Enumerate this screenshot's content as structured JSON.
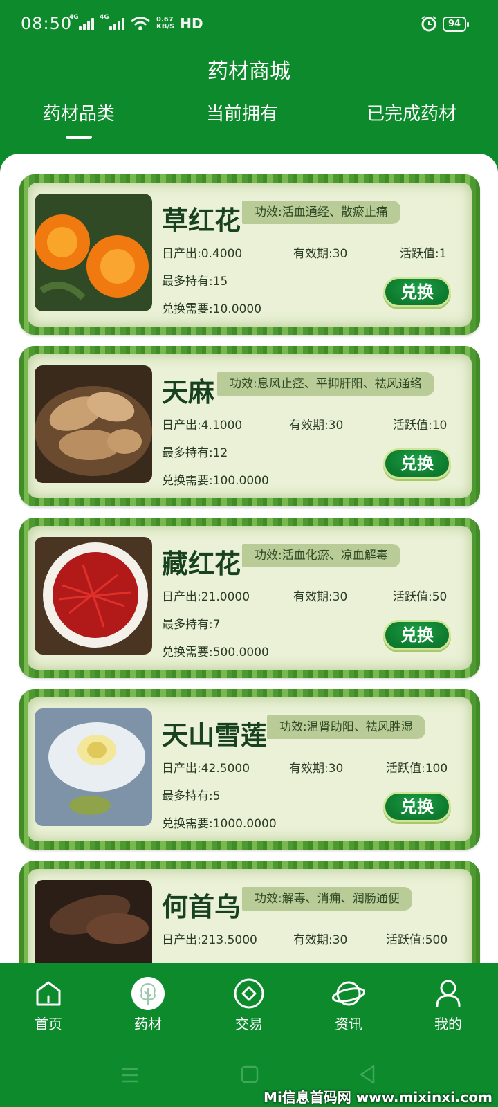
{
  "status": {
    "time": "08:50",
    "signal1": "4G",
    "signal2": "4G",
    "speed_value": "0.67",
    "speed_unit": "KB/S",
    "hd": "HD",
    "battery": "94"
  },
  "header": {
    "title": "药材商城",
    "tabs": [
      "药材品类",
      "当前拥有",
      "已完成药材"
    ],
    "active_tab": "药材品类"
  },
  "items": [
    {
      "name": "草红花",
      "effect": "功效:活血通经、散瘀止痛",
      "daily_output": "日产出:0.4000",
      "validity": "有效期:30",
      "activity": "活跃值:1",
      "max_hold": "最多持有:15",
      "exchange_need": "兑换需要:10.0000",
      "button": "兑换"
    },
    {
      "name": "天麻",
      "effect": "功效:息风止痉、平抑肝阳、祛风通络",
      "daily_output": "日产出:4.1000",
      "validity": "有效期:30",
      "activity": "活跃值:10",
      "max_hold": "最多持有:12",
      "exchange_need": "兑换需要:100.0000",
      "button": "兑换"
    },
    {
      "name": "藏红花",
      "effect": "功效:活血化瘀、凉血解毒",
      "daily_output": "日产出:21.0000",
      "validity": "有效期:30",
      "activity": "活跃值:50",
      "max_hold": "最多持有:7",
      "exchange_need": "兑换需要:500.0000",
      "button": "兑换"
    },
    {
      "name": "天山雪莲",
      "effect": "功效:温肾助阳、祛风胜湿",
      "daily_output": "日产出:42.5000",
      "validity": "有效期:30",
      "activity": "活跃值:100",
      "max_hold": "最多持有:5",
      "exchange_need": "兑换需要:1000.0000",
      "button": "兑换"
    },
    {
      "name": "何首乌",
      "effect": "功效:解毒、消痈、润肠通便",
      "daily_output": "日产出:213.5000",
      "validity": "有效期:30",
      "activity": "活跃值:500"
    }
  ],
  "nav": [
    {
      "label": "首页",
      "icon": "home-icon"
    },
    {
      "label": "药材",
      "icon": "tree-icon",
      "active": true
    },
    {
      "label": "交易",
      "icon": "trade-icon"
    },
    {
      "label": "资讯",
      "icon": "planet-icon"
    },
    {
      "label": "我的",
      "icon": "user-icon"
    }
  ],
  "watermark": "Mi信息首码网 www.mixinxi.com",
  "colors": {
    "brand_green": "#0d8a2c",
    "card_bg": "#eaf1d6",
    "effect_tag": "#b9cb97",
    "name_text": "#18421f"
  }
}
